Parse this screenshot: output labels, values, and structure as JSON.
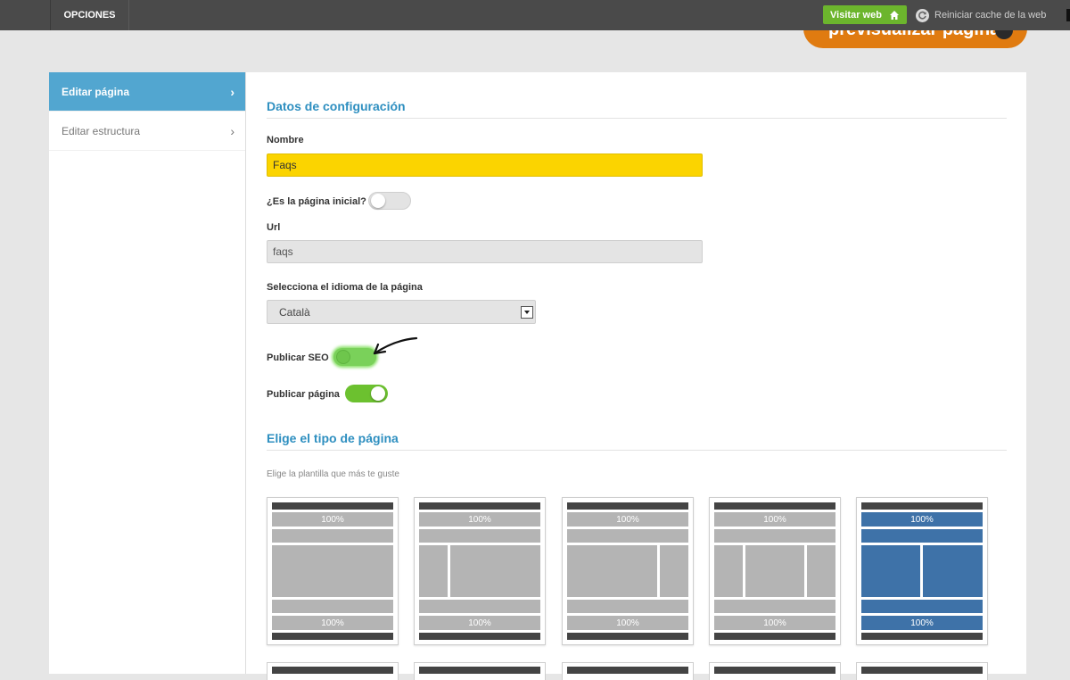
{
  "topbar": {
    "options_label": "OPCIONES",
    "visit_label": "Visitar web",
    "cache_label": "Reiniciar cache de la web"
  },
  "preview": {
    "label": "previsualizar página"
  },
  "sidebar": {
    "items": [
      {
        "label": "Editar página",
        "active": true
      },
      {
        "label": "Editar estructura",
        "active": false
      }
    ]
  },
  "form": {
    "section_title": "Datos de configuración",
    "name_label": "Nombre",
    "name_value": "Faqs",
    "home_label": "¿Es la página inicial?",
    "home_on": false,
    "url_label": "Url",
    "url_value": "faqs",
    "lang_label": "Selecciona el idioma de la página",
    "lang_value": "Català",
    "seo_label": "Publicar SEO",
    "seo_on": false,
    "publish_label": "Publicar página",
    "publish_on": true
  },
  "templates": {
    "section_title": "Elige el tipo de página",
    "hint": "Elige la plantilla que más te guste",
    "width_label": "100%",
    "selected_index": 4,
    "count_first_row": 5
  },
  "colors": {
    "accent_blue": "#52a6d0",
    "title_blue": "#2e8fc0",
    "name_field": "#fbd400",
    "toggle_on": "#6cc12f",
    "visit_button": "#6cb52d",
    "template_selected": "#3e72a8",
    "preview_orange": "#e07b10"
  }
}
